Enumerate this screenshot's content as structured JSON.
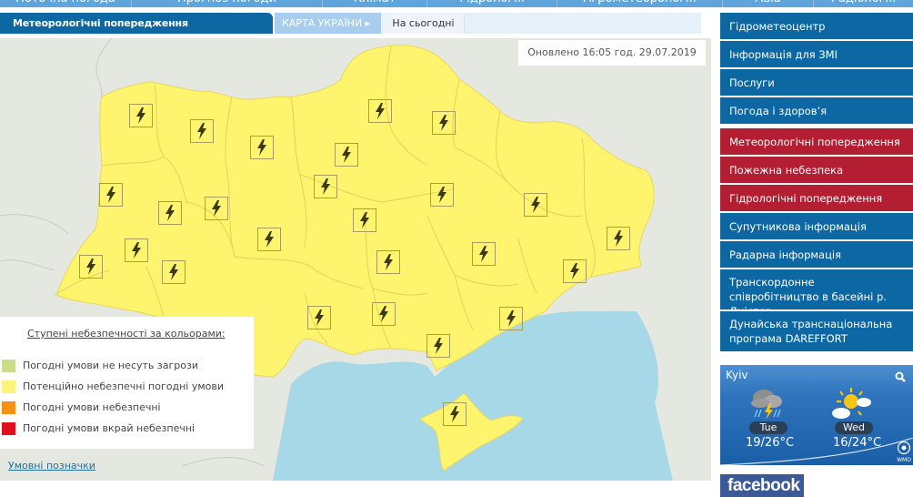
{
  "top_nav": {
    "items": [
      {
        "label": "Поточна погода"
      },
      {
        "label": "Прогноз погоди"
      },
      {
        "label": "Клімат"
      },
      {
        "label": "Гідрологія"
      },
      {
        "label": "Агрометеорологія"
      },
      {
        "label": "Авіа"
      },
      {
        "label": "Радіологія"
      }
    ]
  },
  "header": {
    "title": "Метеорологічні попередження",
    "tabs": [
      {
        "label": "КАРТА УКРАЇНИ ▸",
        "active": true
      },
      {
        "label": "На сьогодні",
        "active": false
      }
    ]
  },
  "map": {
    "updated": "Оновлено 16:05 год. 29.07.2019",
    "region_fill": "#fff46e",
    "sea_color": "#a7d8e8",
    "land_other_color": "#e4e8e1",
    "warning_type": "thunderstorm",
    "warning_icon": "lightning-bolt-icon",
    "warning_count": 26
  },
  "legend": {
    "title": "Ступені небезпечності за кольорами:",
    "items": [
      {
        "label": "Погодні умови не несуть загрози",
        "color": "#c9dd8a"
      },
      {
        "label": "Потенційно небезпечні погодні умови",
        "color": "#fff27a"
      },
      {
        "label": "Погодні умови небезпечні",
        "color": "#f5920f"
      },
      {
        "label": "Погодні умови вкрай небезпечні",
        "color": "#e0101e"
      }
    ],
    "link": "Умовні позначки"
  },
  "sidebar": {
    "items": [
      {
        "label": "Гідрометеоцентр",
        "color": "blue"
      },
      {
        "label": "Інформація для ЗМІ",
        "color": "blue"
      },
      {
        "label": "Послуги",
        "color": "blue"
      },
      {
        "label": "Погода і здоров’я",
        "color": "blue"
      },
      {
        "label": "Метеорологічні попередження",
        "color": "red"
      },
      {
        "label": "Пожежна небезпека",
        "color": "red"
      },
      {
        "label": "Гідрологічні попередження",
        "color": "red"
      },
      {
        "label": "Супутникова інформація",
        "color": "blue"
      },
      {
        "label": "Радарна інформація",
        "color": "blue"
      },
      {
        "label": "Транскордонне співробітництво в басейні р. Дністер",
        "color": "blue"
      },
      {
        "label": "Дунайська транснаціональна програма DAREFFORT",
        "color": "blue"
      }
    ]
  },
  "weather_widget": {
    "city": "Kyiv",
    "days": [
      {
        "day": "Tue",
        "temp": "19/26°C",
        "icon": "thunderstorm-rain-icon"
      },
      {
        "day": "Wed",
        "temp": "16/24°C",
        "icon": "partly-sunny-icon"
      }
    ],
    "badge": "WMO"
  },
  "facebook": {
    "label": "facebook"
  }
}
